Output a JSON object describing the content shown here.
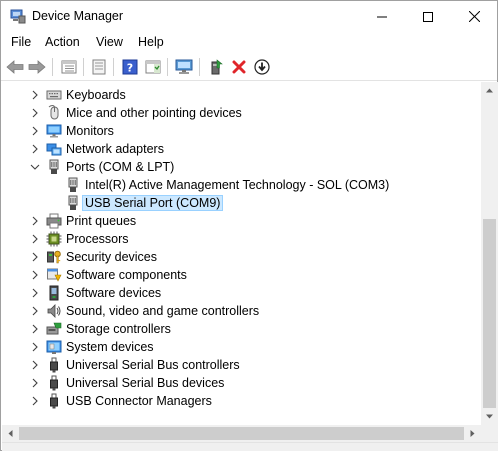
{
  "window": {
    "title": "Device Manager",
    "title_icon": "device-manager-icon",
    "controls": [
      "minimize-icon",
      "maximize-icon",
      "close-icon"
    ]
  },
  "menu": {
    "file": "File",
    "action": "Action",
    "view": "View",
    "help": "Help"
  },
  "toolbar": {
    "buttons": [
      "back-arrow-icon",
      "forward-arrow-icon",
      "properties-list-icon",
      "properties-sheet-icon",
      "help-icon",
      "action-pane-icon",
      "computer-monitor-icon",
      "update-driver-icon",
      "uninstall-device-icon",
      "download-driver-icon"
    ]
  },
  "tree": {
    "items": [
      {
        "label": "Keyboards",
        "icon": "keyboard-icon",
        "level": 0,
        "expanded": false
      },
      {
        "label": "Mice and other pointing devices",
        "icon": "mouse-icon",
        "level": 0,
        "expanded": false
      },
      {
        "label": "Monitors",
        "icon": "monitor-icon",
        "level": 0,
        "expanded": false
      },
      {
        "label": "Network adapters",
        "icon": "network-adapter-icon",
        "level": 0,
        "expanded": false
      },
      {
        "label": "Ports (COM & LPT)",
        "icon": "port-icon",
        "level": 0,
        "expanded": true
      },
      {
        "label": "Intel(R) Active Management Technology - SOL (COM3)",
        "icon": "port-icon",
        "level": 1
      },
      {
        "label": "USB Serial Port (COM9)",
        "icon": "port-icon",
        "level": 1,
        "selected": true
      },
      {
        "label": "Print queues",
        "icon": "printer-icon",
        "level": 0,
        "expanded": false
      },
      {
        "label": "Processors",
        "icon": "processor-icon",
        "level": 0,
        "expanded": false
      },
      {
        "label": "Security devices",
        "icon": "security-key-icon",
        "level": 0,
        "expanded": false
      },
      {
        "label": "Software components",
        "icon": "software-component-icon",
        "level": 0,
        "expanded": false
      },
      {
        "label": "Software devices",
        "icon": "software-device-icon",
        "level": 0,
        "expanded": false
      },
      {
        "label": "Sound, video and game controllers",
        "icon": "speaker-icon",
        "level": 0,
        "expanded": false
      },
      {
        "label": "Storage controllers",
        "icon": "storage-controller-icon",
        "level": 0,
        "expanded": false
      },
      {
        "label": "System devices",
        "icon": "system-device-icon",
        "level": 0,
        "expanded": false
      },
      {
        "label": "Universal Serial Bus controllers",
        "icon": "usb-icon",
        "level": 0,
        "expanded": false
      },
      {
        "label": "Universal Serial Bus devices",
        "icon": "usb-icon",
        "level": 0,
        "expanded": false
      },
      {
        "label": "USB Connector Managers",
        "icon": "usb-icon",
        "level": 0,
        "expanded": false
      }
    ]
  },
  "colors": {
    "selection_bg": "#cce8ff",
    "selection_border": "#99d1ff",
    "scrollbar_track": "#f0f0f0",
    "scrollbar_thumb": "#cdcdcd",
    "uninstall_red": "#e0252a"
  }
}
